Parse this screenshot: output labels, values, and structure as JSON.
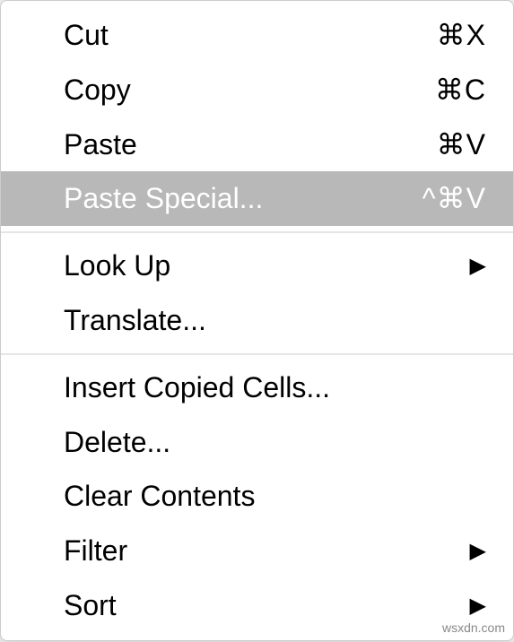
{
  "menu": {
    "groups": [
      {
        "items": [
          {
            "label": "Cut",
            "shortcut": "⌘X",
            "highlighted": false,
            "submenu": false
          },
          {
            "label": "Copy",
            "shortcut": "⌘C",
            "highlighted": false,
            "submenu": false
          },
          {
            "label": "Paste",
            "shortcut": "⌘V",
            "highlighted": false,
            "submenu": false
          },
          {
            "label": "Paste Special...",
            "shortcut": "^⌘V",
            "highlighted": true,
            "submenu": false
          }
        ]
      },
      {
        "items": [
          {
            "label": "Look Up",
            "shortcut": "",
            "highlighted": false,
            "submenu": true
          },
          {
            "label": "Translate...",
            "shortcut": "",
            "highlighted": false,
            "submenu": false
          }
        ]
      },
      {
        "items": [
          {
            "label": "Insert Copied Cells...",
            "shortcut": "",
            "highlighted": false,
            "submenu": false
          },
          {
            "label": "Delete...",
            "shortcut": "",
            "highlighted": false,
            "submenu": false
          },
          {
            "label": "Clear Contents",
            "shortcut": "",
            "highlighted": false,
            "submenu": false
          },
          {
            "label": "Filter",
            "shortcut": "",
            "highlighted": false,
            "submenu": true
          },
          {
            "label": "Sort",
            "shortcut": "",
            "highlighted": false,
            "submenu": true
          }
        ]
      }
    ]
  },
  "watermark": "wsxdn.com"
}
